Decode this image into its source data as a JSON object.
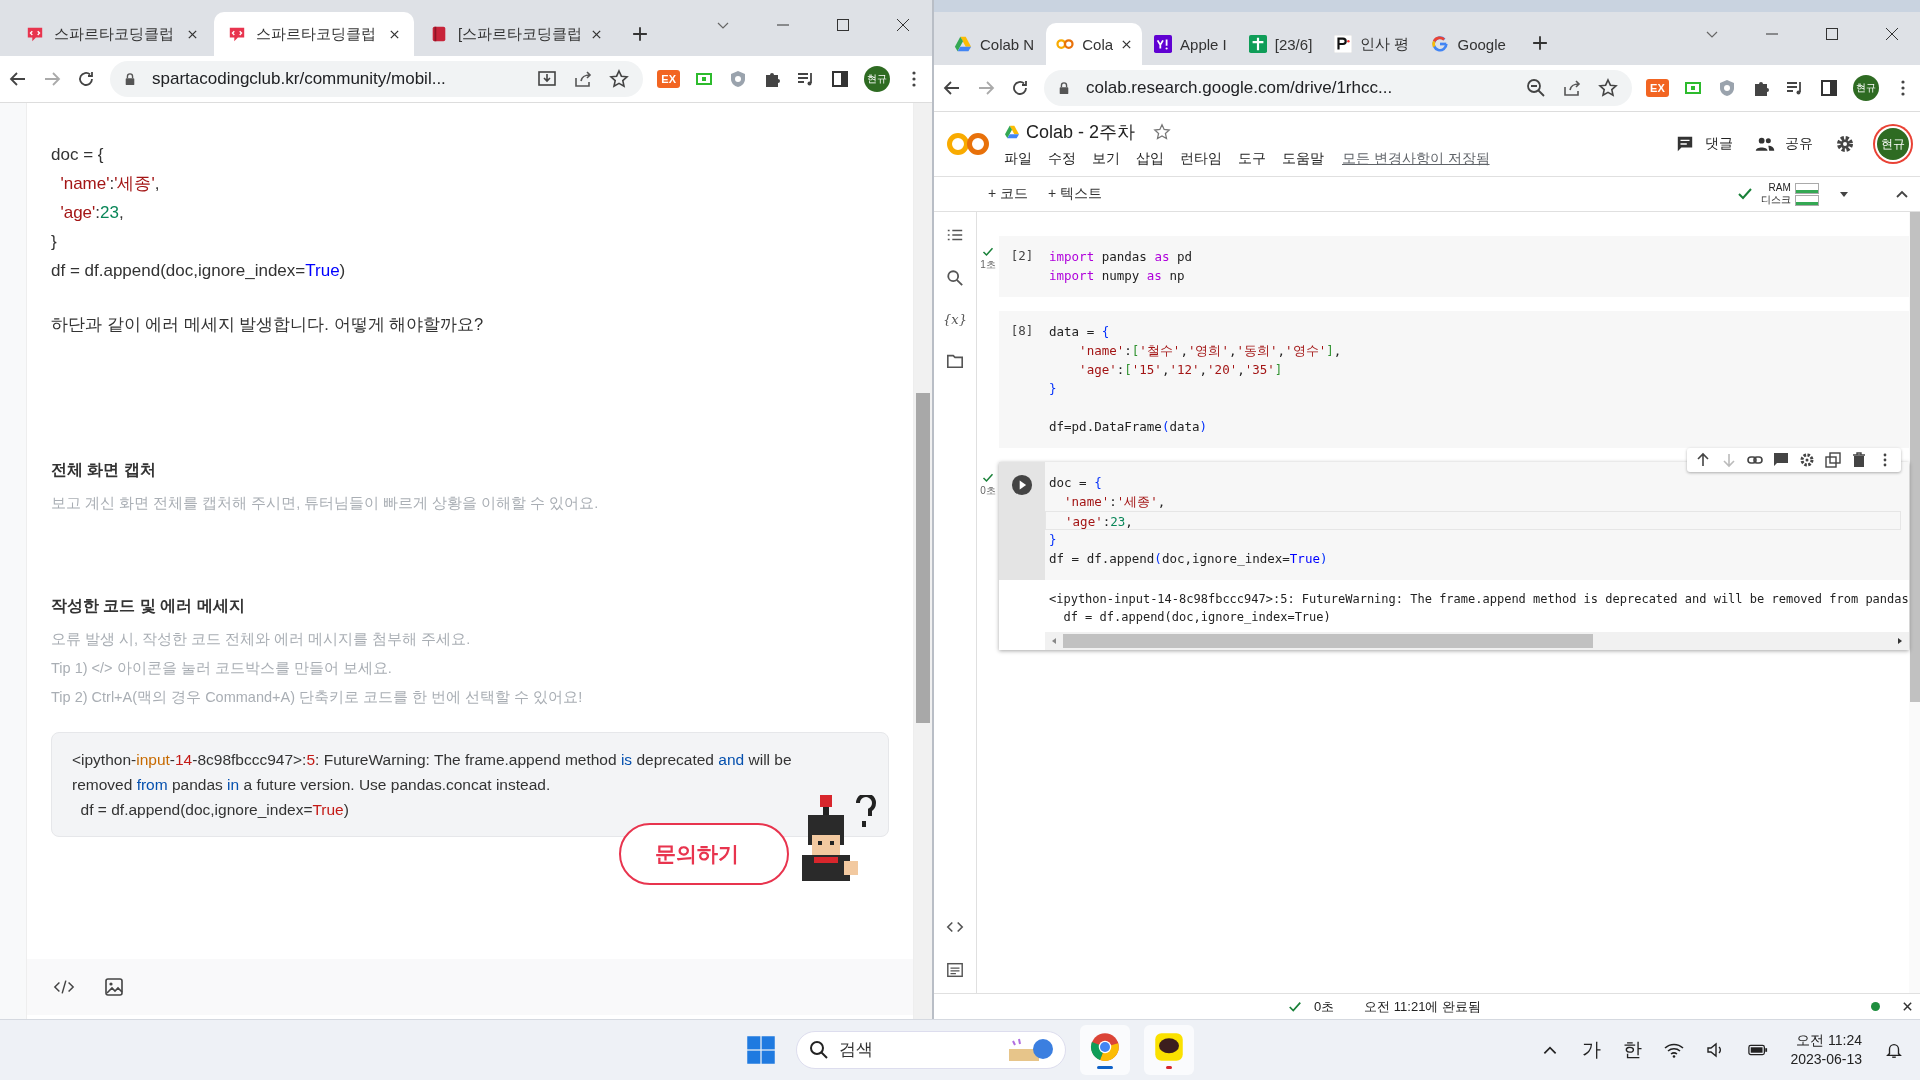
{
  "left_window": {
    "tabs": [
      {
        "label": "스파르타코딩클럽",
        "selected": false,
        "kind": "sparta"
      },
      {
        "label": "스파르타코딩클럽",
        "selected": true,
        "kind": "sparta"
      },
      {
        "label": "[스파르타코딩클럽",
        "selected": false,
        "kind": "book"
      }
    ],
    "address": "spartacodingclub.kr/community/mobil...",
    "extension_badge": "EX",
    "profile": "현규",
    "code_lines": [
      [
        {
          "text": "doc = {",
          "kind": "plain"
        }
      ],
      [
        {
          "text": "  'name'",
          "kind": "string"
        },
        {
          "text": ":",
          "kind": "plain"
        },
        {
          "text": "'세종'",
          "kind": "string"
        },
        {
          "text": ",",
          "kind": "plain"
        }
      ],
      [
        {
          "text": "  'age'",
          "kind": "string"
        },
        {
          "text": ":",
          "kind": "plain"
        },
        {
          "text": "23",
          "kind": "number"
        },
        {
          "text": ",",
          "kind": "plain"
        }
      ],
      [
        {
          "text": "}",
          "kind": "plain"
        }
      ],
      [
        {
          "text": "df = df.append(doc,ignore_index=",
          "kind": "plain"
        },
        {
          "text": "True",
          "kind": "constant"
        },
        {
          "text": ")",
          "kind": "plain"
        }
      ]
    ],
    "question": "하단과 같이 에러 메세지 발생합니다. 어떻게 해야할까요?",
    "sections": [
      {
        "heading": "전체 화면 캡처",
        "hints": [
          "보고 계신 화면 전체를 캡처해 주시면, 튜터님들이 빠르게 상황을 이해할 수 있어요."
        ]
      },
      {
        "heading": "작성한 코드 및 에러 메세지",
        "hints": [
          "오류 발생 시, 작성한 코드 전체와 에러 메시지를 첨부해 주세요.",
          "Tip 1) </> 아이콘을 눌러 코드박스를 만들어 보세요.",
          "Tip 2) Ctrl+A(맥의 경우 Command+A) 단축키로 코드를 한 번에 선택할 수 있어요!"
        ]
      }
    ],
    "error_lines": [
      [
        {
          "text": "<ipython-",
          "kind": "plain"
        },
        {
          "text": "input",
          "kind": "name"
        },
        {
          "text": "-",
          "kind": "plain"
        },
        {
          "text": "14",
          "kind": "number"
        },
        {
          "text": "-8c98fbccc947>:",
          "kind": "plain"
        },
        {
          "text": "5",
          "kind": "number"
        },
        {
          "text": ": FutureWarning: The frame.append method ",
          "kind": "plain"
        },
        {
          "text": "is",
          "kind": "operator"
        },
        {
          "text": " deprecated ",
          "kind": "plain"
        },
        {
          "text": "and",
          "kind": "operator"
        },
        {
          "text": " will be",
          "kind": "plain"
        }
      ],
      [
        {
          "text": "removed ",
          "kind": "plain"
        },
        {
          "text": "from",
          "kind": "operator"
        },
        {
          "text": " pandas ",
          "kind": "plain"
        },
        {
          "text": "in",
          "kind": "operator"
        },
        {
          "text": " a future version. Use pandas.concat instead.",
          "kind": "plain"
        }
      ],
      [
        {
          "text": "  df = df.append(doc,ignore_index=",
          "kind": "plain"
        },
        {
          "text": "True",
          "kind": "constant"
        },
        {
          "text": ")",
          "kind": "plain"
        }
      ]
    ],
    "ask_button": "문의하기"
  },
  "right_window": {
    "tabs": [
      {
        "label": "Colab N",
        "selected": false,
        "kind": "drive"
      },
      {
        "label": "Cola",
        "selected": true,
        "kind": "colab"
      },
      {
        "label": "Apple I",
        "selected": false,
        "kind": "yahoo"
      },
      {
        "label": "[23/6] ",
        "selected": false,
        "kind": "sheets"
      },
      {
        "label": "인사 평",
        "selected": false,
        "kind": "p"
      },
      {
        "label": "Google",
        "selected": false,
        "kind": "google"
      }
    ],
    "address": "colab.research.google.com/drive/1rhcc...",
    "extension_badge": "EX",
    "profile": "현규",
    "notebook_title": "Colab - 2주차",
    "menu": [
      "파일",
      "수정",
      "보기",
      "삽입",
      "런타임",
      "도구",
      "도움말"
    ],
    "saved_note": "모든 변경사항이 저장됨",
    "comment": "댓글",
    "share": "공유",
    "account": "현규",
    "add_code": "+ 코드",
    "add_text": "+ 텍스트",
    "ram": "RAM",
    "disk": "디스크",
    "variables_icon": "{x}",
    "cells": [
      {
        "ran": true,
        "time": "1초",
        "count": "[2]",
        "selected": false,
        "lines": [
          [
            {
              "text": "import",
              "kind": "keyword"
            },
            {
              "text": " pandas ",
              "kind": "plain"
            },
            {
              "text": "as",
              "kind": "keyword"
            },
            {
              "text": " pd",
              "kind": "plain"
            }
          ],
          [
            {
              "text": "import",
              "kind": "keyword"
            },
            {
              "text": " numpy ",
              "kind": "plain"
            },
            {
              "text": "as",
              "kind": "keyword"
            },
            {
              "text": " np",
              "kind": "plain"
            }
          ]
        ]
      },
      {
        "ran": false,
        "count": "[8]",
        "selected": false,
        "lines": [
          [
            {
              "text": "data = ",
              "kind": "plain"
            },
            {
              "text": "{",
              "kind": "bracket"
            }
          ],
          [
            {
              "text": "    'name'",
              "kind": "string"
            },
            {
              "text": ":",
              "kind": "plain"
            },
            {
              "text": "[",
              "kind": "bracket2"
            },
            {
              "text": "'철수'",
              "kind": "string"
            },
            {
              "text": ",",
              "kind": "plain"
            },
            {
              "text": "'영희'",
              "kind": "string"
            },
            {
              "text": ",",
              "kind": "plain"
            },
            {
              "text": "'동희'",
              "kind": "string"
            },
            {
              "text": ",",
              "kind": "plain"
            },
            {
              "text": "'영수'",
              "kind": "string"
            },
            {
              "text": "]",
              "kind": "bracket2"
            },
            {
              "text": ",",
              "kind": "plain"
            }
          ],
          [
            {
              "text": "    'age'",
              "kind": "string"
            },
            {
              "text": ":",
              "kind": "plain"
            },
            {
              "text": "[",
              "kind": "bracket2"
            },
            {
              "text": "'15'",
              "kind": "string"
            },
            {
              "text": ",",
              "kind": "plain"
            },
            {
              "text": "'12'",
              "kind": "string"
            },
            {
              "text": ",",
              "kind": "plain"
            },
            {
              "text": "'20'",
              "kind": "string"
            },
            {
              "text": ",",
              "kind": "plain"
            },
            {
              "text": "'35'",
              "kind": "string"
            },
            {
              "text": "]",
              "kind": "bracket2"
            }
          ],
          [
            {
              "text": "}",
              "kind": "bracket"
            }
          ]
        ],
        "tail_lines": [
          [
            {
              "text": "df=pd.DataFrame",
              "kind": "plain"
            },
            {
              "text": "(",
              "kind": "bracket"
            },
            {
              "text": "data",
              "kind": "plain"
            },
            {
              "text": ")",
              "kind": "bracket"
            }
          ]
        ]
      },
      {
        "ran": true,
        "time": "0초",
        "selected": true,
        "lines": [
          [
            {
              "text": "doc = ",
              "kind": "plain"
            },
            {
              "text": "{",
              "kind": "bracket"
            }
          ],
          [
            {
              "text": "  'name'",
              "kind": "string"
            },
            {
              "text": ":",
              "kind": "plain"
            },
            {
              "text": "'세종'",
              "kind": "string"
            },
            {
              "text": ",",
              "kind": "plain"
            }
          ],
          [
            {
              "text": "  'age'",
              "kind": "string"
            },
            {
              "text": ":",
              "kind": "plain"
            },
            {
              "text": "23",
              "kind": "number"
            },
            {
              "text": ",",
              "kind": "plain"
            }
          ],
          [
            {
              "text": "}",
              "kind": "bracket"
            }
          ],
          [
            {
              "text": "df = df.append",
              "kind": "plain"
            },
            {
              "text": "(",
              "kind": "bracket"
            },
            {
              "text": "doc,ignore_index=",
              "kind": "plain"
            },
            {
              "text": "True",
              "kind": "constant"
            },
            {
              "text": ")",
              "kind": "bracket"
            }
          ]
        ],
        "output": [
          "<ipython-input-14-8c98fbccc947>:5: FutureWarning: The frame.append method is deprecated and will be removed from pandas",
          "  df = df.append(doc,ignore_index=True)"
        ]
      }
    ],
    "status_time": "0초",
    "status_text": "오전 11:21에 완료됨"
  },
  "taskbar": {
    "search_placeholder": "검색",
    "ime_mode": "가",
    "ime_lang": "한",
    "time": "오전 11:24",
    "date": "2023-06-13"
  }
}
